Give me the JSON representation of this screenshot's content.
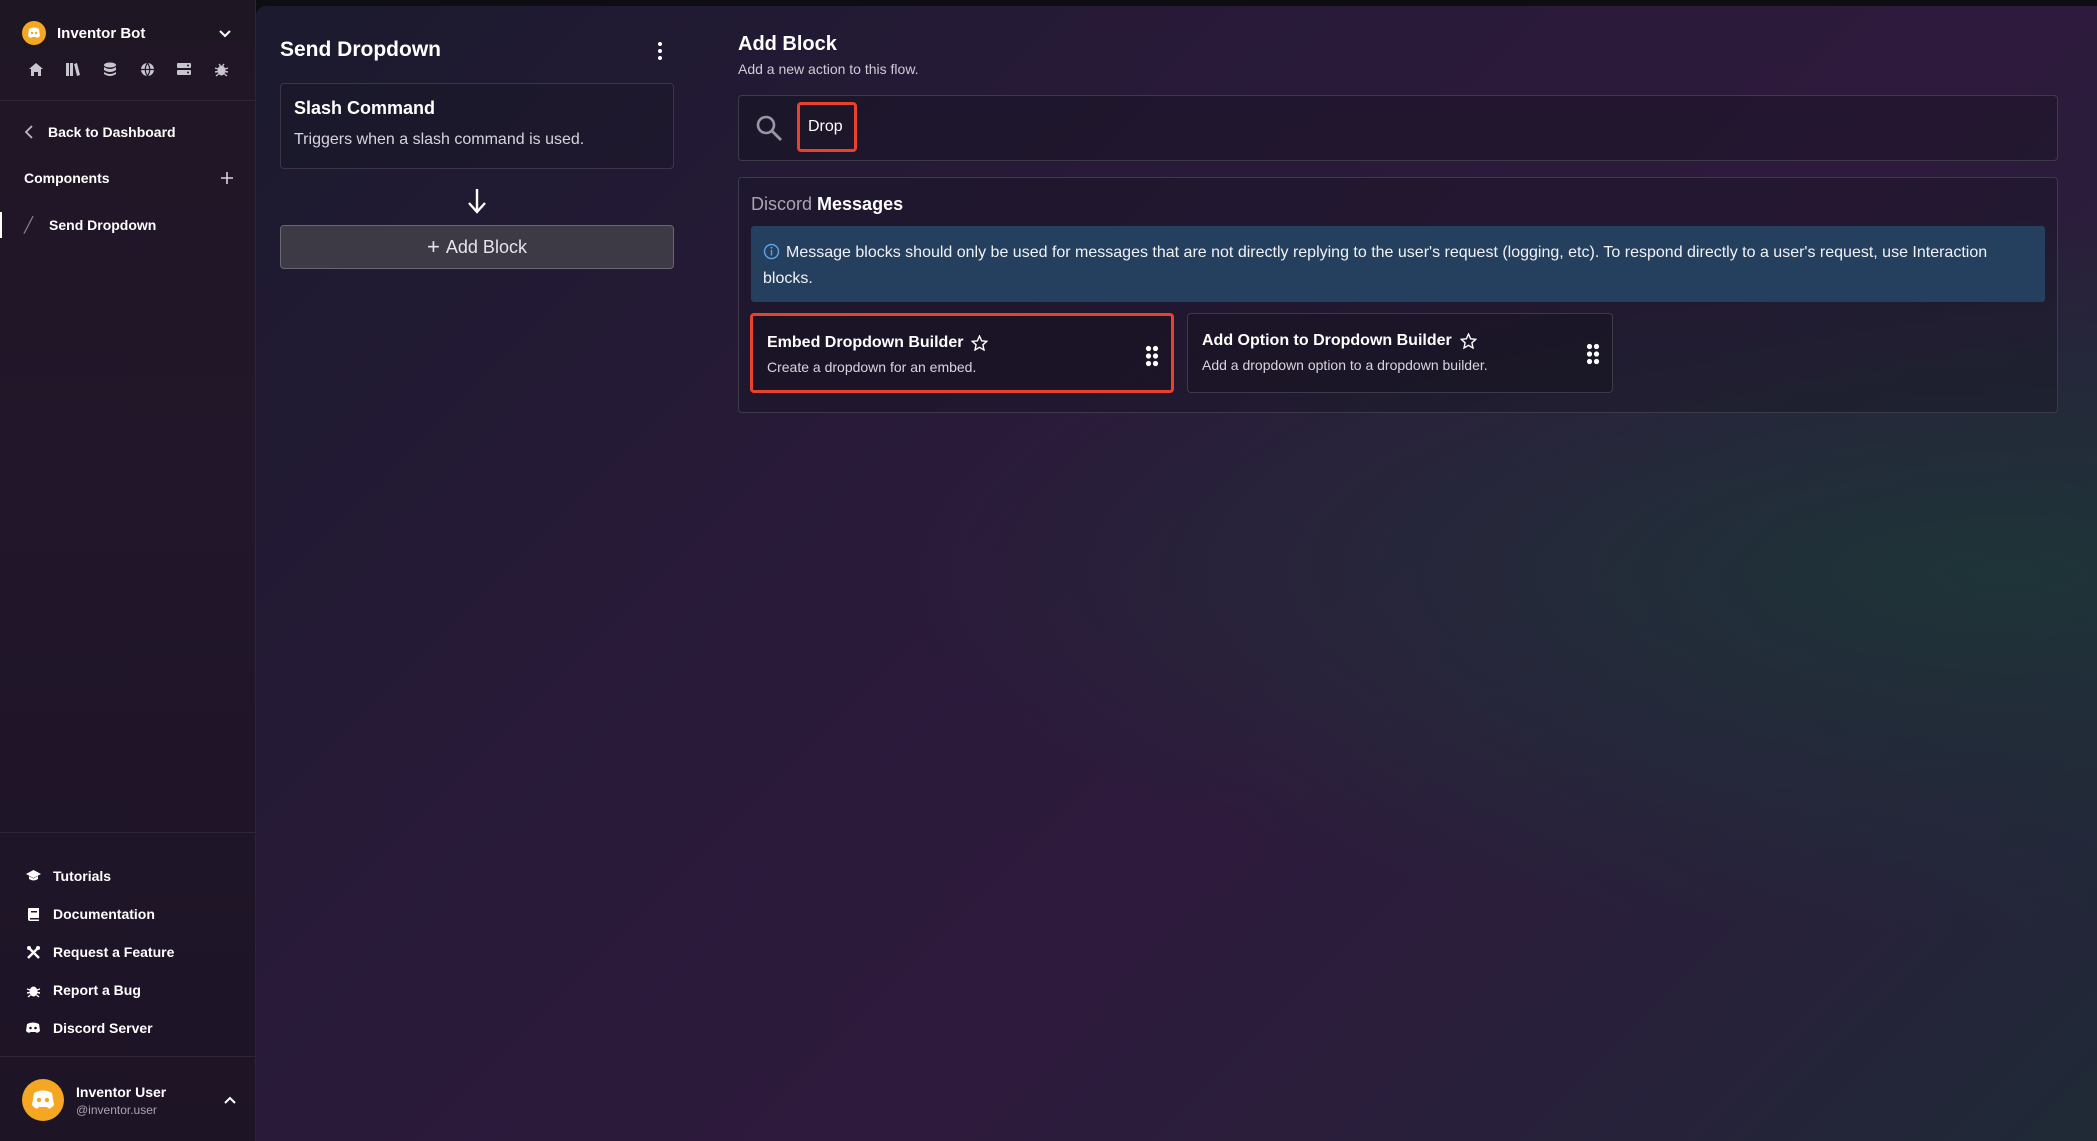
{
  "sidebar": {
    "bot_name": "Inventor Bot",
    "nav_icons": [
      "home-icon",
      "library-icon",
      "database-icon",
      "globe-icon",
      "server-icon",
      "bug-icon"
    ],
    "back_label": "Back to Dashboard",
    "components_label": "Components",
    "components": [
      {
        "label": "Send Dropdown"
      }
    ],
    "help_links": [
      {
        "label": "Tutorials",
        "icon": "graduation-cap-icon"
      },
      {
        "label": "Documentation",
        "icon": "book-icon"
      },
      {
        "label": "Request a Feature",
        "icon": "tools-icon"
      },
      {
        "label": "Report a Bug",
        "icon": "bug-icon"
      },
      {
        "label": "Discord Server",
        "icon": "discord-icon"
      }
    ],
    "user": {
      "name": "Inventor User",
      "handle": "@inventor.user"
    }
  },
  "flow": {
    "title": "Send Dropdown",
    "trigger_title": "Slash Command",
    "trigger_desc": "Triggers when a slash command is used.",
    "add_block_label": "Add Block"
  },
  "add_block_panel": {
    "title": "Add Block",
    "subtitle": "Add a new action to this flow.",
    "search_value": "Drop",
    "category_prefix": "Discord",
    "category_name": "Messages",
    "info_text": "Message blocks should only be used for messages that are not directly replying to the user's request (logging, etc). To respond directly to a user's request, use Interaction blocks.",
    "blocks": [
      {
        "name": "Embed Dropdown Builder",
        "desc": "Create a dropdown for an embed."
      },
      {
        "name": "Add Option to Dropdown Builder",
        "desc": "Add a dropdown option to a dropdown builder."
      }
    ]
  },
  "colors": {
    "accent_highlight": "#e8412c",
    "info_bg": "#24405e",
    "avatar": "#f5a623"
  }
}
